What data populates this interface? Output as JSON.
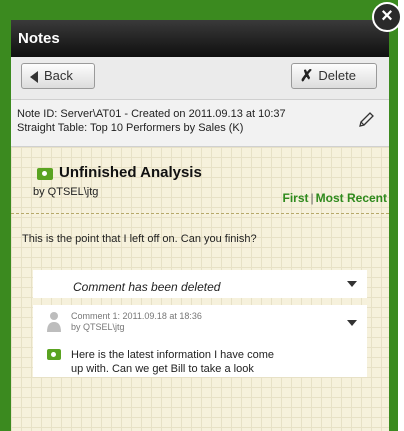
{
  "dialog": {
    "title": "Notes",
    "close_symbol": "×"
  },
  "toolbar": {
    "back_label": "Back",
    "delete_label": "Delete"
  },
  "info": {
    "line1": "Note ID: Server\\AT01 - Created on 2011.09.13 at 10:37",
    "line2": "Straight Table: Top 10 Performers by Sales (K)"
  },
  "note": {
    "title": "Unfinished Analysis",
    "author": "by QTSEL\\jtg",
    "nav_first": "First",
    "nav_separator": "|",
    "nav_recent": "Most Recent",
    "message": "This is the point that I left off on. Can you finish?"
  },
  "comments": [
    {
      "text": "Comment has been deleted"
    },
    {
      "meta": "Comment 1: 2011.09.18 at 18:36",
      "author": "by QTSEL\\jtg",
      "text": "Here is the latest information I have come up with.  Can we get Bill to take a look"
    }
  ],
  "colors": {
    "frame_green": "#3b8a1f",
    "link_green": "#2f8a1d",
    "note_icon_green": "#5aa321"
  }
}
